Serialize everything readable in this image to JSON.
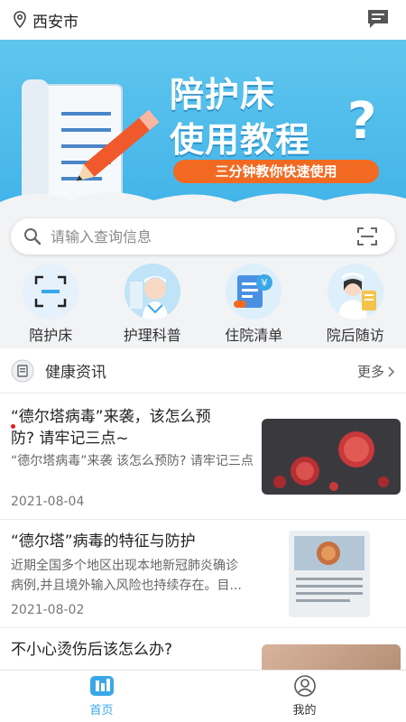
{
  "header": {
    "location": "西安市",
    "location_icon": "location-pin-icon",
    "message_icon": "message-icon"
  },
  "banner": {
    "title_line1": "陪护床",
    "title_line2": "使用教程",
    "question_mark": "?",
    "pill_text": "三分钟教你快速使用"
  },
  "search": {
    "placeholder": "请输入查询信息"
  },
  "quick_menu": [
    {
      "label": "陪护床",
      "icon": "scan-bed-icon"
    },
    {
      "label": "护理科普",
      "icon": "nurse-icon"
    },
    {
      "label": "住院清单",
      "icon": "bill-list-icon"
    },
    {
      "label": "院后随访",
      "icon": "nurse-clipboard-icon"
    }
  ],
  "news": {
    "title": "健康资讯",
    "more": "更多",
    "articles": [
      {
        "title_line1": "“德尔塔病毒”来袭，该怎么预",
        "title_line2": "防? 请牢记三点~",
        "summary_line1": "“德尔塔病毒”来袭 该怎么预防? 请牢记三点",
        "summary_line2": "",
        "date": "2021-08-04"
      },
      {
        "title_line1": "“德尔塔”病毒的特征与防护",
        "title_line2": "",
        "summary_line1": "近期全国多个地区出现本地新冠肺炎确诊",
        "summary_line2": "病例,并且境外输入风险也持续存在。目...",
        "date": "2021-08-02"
      },
      {
        "title_line1": "不小心烫伤后该怎么办?",
        "title_line2": "",
        "summary_line1": "",
        "summary_line2": "",
        "date": ""
      }
    ]
  },
  "tabbar": {
    "home": "首页",
    "mine": "我的"
  },
  "colors": {
    "accent": "#3aa8e8",
    "banner_bg": "#4ab8ec",
    "pill": "#f26a22"
  }
}
